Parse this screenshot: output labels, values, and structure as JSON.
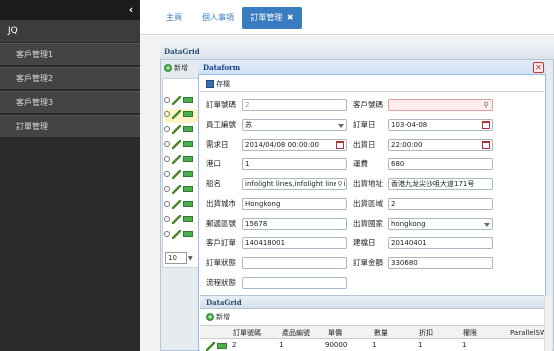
{
  "sidebar": {
    "brand": "JQ",
    "items": [
      "客戶管理1",
      "客戶管理2",
      "客戶管理3",
      "訂單管理"
    ]
  },
  "tabs": {
    "home": "主頁",
    "personal": "個人事項",
    "active": "訂單管理",
    "close_glyph": "✖"
  },
  "datagrid": {
    "title": "DataGrid",
    "add_label": "新增",
    "page_size": "10"
  },
  "dataform": {
    "title": "Dataform",
    "save_label": "存檔",
    "close_glyph": "✕",
    "fields": {
      "order_no": {
        "label": "訂單號碼",
        "value": "2"
      },
      "customer_no": {
        "label": "客戶號碼",
        "value": ""
      },
      "employee_no": {
        "label": "員工編號",
        "value": "苏"
      },
      "order_date": {
        "label": "訂單日",
        "value": "103-04-08"
      },
      "required_date": {
        "label": "需求日",
        "value": "2014/04/08 00:00:00"
      },
      "ship_date": {
        "label": "出貨日",
        "value": "22:00:00"
      },
      "port": {
        "label": "港口",
        "value": "1"
      },
      "freight": {
        "label": "運費",
        "value": "680"
      },
      "ship_name": {
        "label": "船名",
        "value": "infolight lines,infolight lines,ir"
      },
      "ship_address": {
        "label": "出貨地址",
        "value": "香港九龙尖沙咀大道171号"
      },
      "ship_city": {
        "label": "出貨城市",
        "value": "Hongkong"
      },
      "ship_region": {
        "label": "出貨區域",
        "value": "2"
      },
      "postal_code": {
        "label": "郵遞區號",
        "value": "15678"
      },
      "ship_country": {
        "label": "出貨國家",
        "value": "hongkong"
      },
      "customer_order": {
        "label": "客戶訂單",
        "value": "140418001"
      },
      "create_date": {
        "label": "建檔日",
        "value": "20140401"
      },
      "order_status": {
        "label": "訂單狀態",
        "value": ""
      },
      "order_amount": {
        "label": "訂單金額",
        "value": "330680"
      },
      "flow_status": {
        "label": "流程狀態",
        "value": ""
      }
    }
  },
  "inner_grid": {
    "title": "DataGrid",
    "add_label": "新增",
    "columns": [
      "訂單號碼",
      "產品編號",
      "單價",
      "數量",
      "折扣",
      "權限",
      "ParallelSW"
    ],
    "row": [
      "2",
      "1",
      "90000",
      "1",
      "1",
      "1",
      ""
    ]
  },
  "colors": {
    "accent": "#3a7cc0",
    "sidebar_bg": "#2b2b2b"
  }
}
